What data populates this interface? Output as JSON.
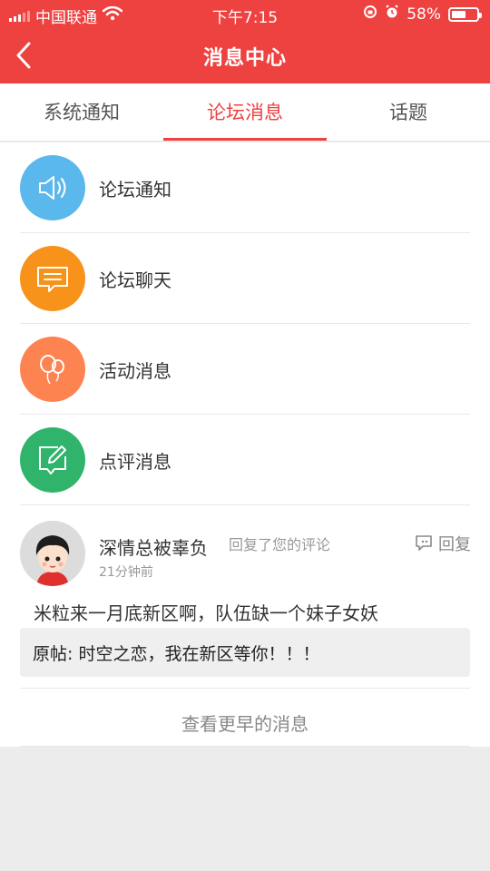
{
  "status_bar": {
    "carrier": "中国联通",
    "time": "下午7:15",
    "battery": "58%",
    "battery_level": 0.58
  },
  "header": {
    "title": "消息中心"
  },
  "tabs": [
    {
      "label": "系统通知",
      "active": false
    },
    {
      "label": "论坛消息",
      "active": true
    },
    {
      "label": "话题",
      "active": false
    }
  ],
  "categories": [
    {
      "label": "论坛通知",
      "icon": "speaker-icon",
      "color": "#5bb8ec"
    },
    {
      "label": "论坛聊天",
      "icon": "chat-icon",
      "color": "#f7921a"
    },
    {
      "label": "活动消息",
      "icon": "balloon-icon",
      "color": "#fd8351"
    },
    {
      "label": "点评消息",
      "icon": "edit-icon",
      "color": "#30b46b"
    }
  ],
  "message": {
    "user": "深情总被辜负",
    "action": "回复了您的评论",
    "time": "21分钟前",
    "reply_label": "回复",
    "body": "米粒来一月底新区啊，队伍缺一个妹子女妖",
    "quote": "原帖: 时空之恋，我在新区等你！！！"
  },
  "more_label": "查看更早的消息",
  "colors": {
    "brand": "#ee4241",
    "background": "#ececec"
  }
}
